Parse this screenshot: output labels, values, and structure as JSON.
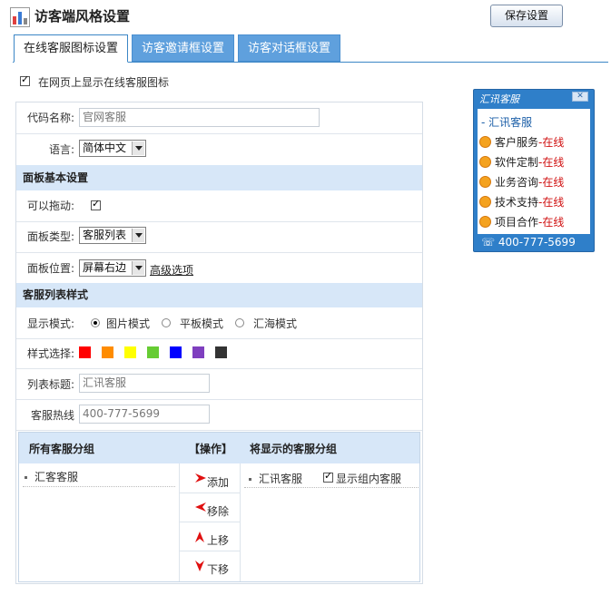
{
  "header": {
    "title": "访客端风格设置",
    "save_label": "保存设置"
  },
  "tabs": [
    {
      "label": "在线客服图标设置",
      "active": true
    },
    {
      "label": "访客邀请框设置",
      "active": false
    },
    {
      "label": "访客对话框设置",
      "active": false
    }
  ],
  "show_icon": {
    "label": "在网页上显示在线客服图标",
    "checked": true
  },
  "form": {
    "code_name": {
      "label": "代码名称:",
      "value": "官网客服"
    },
    "language": {
      "label": "语言:",
      "value": "简体中文"
    },
    "panel_section": "面板基本设置",
    "draggable": {
      "label": "可以拖动:",
      "checked": true
    },
    "panel_type": {
      "label": "面板类型:",
      "value": "客服列表"
    },
    "panel_position": {
      "label": "面板位置:",
      "value": "屏幕右边",
      "advanced_link": "高级选项"
    },
    "list_section": "客服列表样式",
    "display_mode": {
      "label": "显示模式:",
      "options": [
        {
          "label": "图片模式",
          "selected": true
        },
        {
          "label": "平板模式",
          "selected": false
        },
        {
          "label": "汇海模式",
          "selected": false
        }
      ]
    },
    "style_select": {
      "label": "样式选择:",
      "colors": [
        "#ff0000",
        "#ff8c00",
        "#ffff00",
        "#66cc33",
        "#0000ff",
        "#7f3fbf",
        "#333333"
      ]
    },
    "list_title": {
      "label": "列表标题:",
      "value": "汇讯客服"
    },
    "hotline": {
      "label": "客服热线",
      "value": "400-777-5699"
    }
  },
  "groups": {
    "all_header": "所有客服分组",
    "ops_header": "【操作】",
    "shown_header": "将显示的客服分组",
    "all_items": [
      "汇客客服"
    ],
    "shown_items": [
      {
        "name": "汇讯客服",
        "option": "显示组内客服",
        "checked": true
      }
    ],
    "ops": {
      "add": "添加",
      "remove": "移除",
      "up": "上移",
      "down": "下移"
    }
  },
  "preview": {
    "title": "汇讯客服",
    "close": "✕",
    "heading": "- 汇讯客服",
    "items": [
      {
        "name": "客户服务",
        "status": "-在线"
      },
      {
        "name": "软件定制",
        "status": "-在线"
      },
      {
        "name": "业务咨询",
        "status": "-在线"
      },
      {
        "name": "技术支持",
        "status": "-在线"
      },
      {
        "name": "项目合作",
        "status": "-在线"
      }
    ],
    "phone": "☏ 400-777-5699"
  }
}
